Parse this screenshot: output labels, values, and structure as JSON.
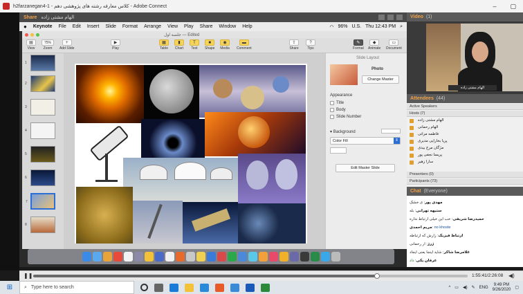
{
  "window": {
    "title": "h2farzanegan4-1 - کلاس معارفه رشته های پژوهشی دهم - Adobe Connect",
    "controls": [
      "–",
      "▢"
    ]
  },
  "share_pod": {
    "label": "Share",
    "presenter": "الهام مشتی زاده"
  },
  "mac_menubar": {
    "apple": "",
    "items": [
      "Keynote",
      "File",
      "Edit",
      "Insert",
      "Slide",
      "Format",
      "Arrange",
      "View",
      "Play",
      "Share",
      "Window",
      "Help"
    ],
    "battery": "96%",
    "input_source": "U.S.",
    "clock": "Thu 12:43 PM"
  },
  "keynote": {
    "doc_title": "جلسه اول — Edited",
    "toolbar": [
      "View",
      "Zoom",
      "Add Slide",
      "Play",
      "Table",
      "Chart",
      "Text",
      "Shape",
      "Media",
      "Comment",
      "Share",
      "Tips",
      "Format",
      "Animate",
      "Document"
    ],
    "zoom_value": "75%",
    "slide_numbers": [
      "1",
      "2",
      "3",
      "4",
      "5",
      "6",
      "7",
      "8"
    ]
  },
  "format_panel": {
    "header": "Slide Layout",
    "layout_name": "Photo",
    "change_master": "Change Master",
    "appearance": "Appearance",
    "options": [
      "Title",
      "Body",
      "Slide Number"
    ],
    "background": "Background",
    "fill": "Color Fill",
    "edit_master": "Edit Master Slide"
  },
  "video_pod": {
    "label": "Video",
    "count": "(1)",
    "speaker_name": "الهام مشتی زاده"
  },
  "attendees": {
    "label": "Attendees",
    "count": "(44)",
    "active_speakers": "Active Speakers",
    "hosts": "Hosts (7)",
    "host_names": [
      "الهام مشتی زاده",
      "الهام رحمانی",
      "فاطمه مراتی",
      "پریا بخارایی مدیری",
      "مژگان مرج بیدی",
      "پریسا نجفی پور",
      "سارا زهیر"
    ],
    "presenters": "Presenters (0)",
    "participants": "Participants (73)"
  },
  "chat": {
    "label": "Chat",
    "scope": "(Everyone)",
    "messages": [
      {
        "name": "مهدی پور",
        "text": "ی خشک"
      },
      {
        "name": "ستیهه تهرانی",
        "text": "بله"
      },
      {
        "name": "حمیدرضا شریفی",
        "text": "خب این خیلی ارتباط نداره"
      },
      {
        "name": "مریم احمدی",
        "text": "no khoste"
      },
      {
        "name": "ارتباط فیزیک",
        "text": "زارش که ارتباطه"
      },
      {
        "name": "ژرژ",
        "text": "ار رحمانی"
      },
      {
        "name": "غلامرضا شاکر",
        "text": "شاید اینجا یعنی ایجاد"
      },
      {
        "name": "عرفان یکی",
        "text": "داد"
      }
    ]
  },
  "player": {
    "time": "1:55:41/2:26:08",
    "progress": 0.792
  },
  "taskbar": {
    "search_placeholder": "Type here to search",
    "tray_lang": "ENG",
    "time": "9:49 PM",
    "date": "9/26/2020"
  },
  "colors": {
    "share_accent": "#f2a24a",
    "keynote_yellow": "#f6d35b",
    "windows_blue": "#0a64c8"
  }
}
